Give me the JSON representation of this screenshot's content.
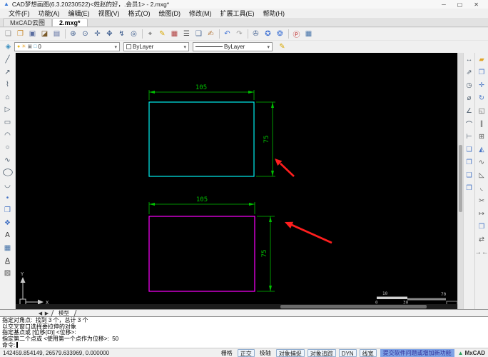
{
  "window": {
    "icon_glyph": "▲",
    "title": "CAD梦想画图(6.3.20230522)<姓赵的好，.会员1> - 2.mxg*",
    "controls": {
      "minimize": "─",
      "maximize": "▢",
      "close": "✕"
    }
  },
  "menu": {
    "items": [
      {
        "name": "menu-file",
        "label": "文件(F)"
      },
      {
        "name": "menu-function",
        "label": "功能(A)"
      },
      {
        "name": "menu-edit",
        "label": "编辑(E)"
      },
      {
        "name": "menu-view",
        "label": "视图(V)"
      },
      {
        "name": "menu-format",
        "label": "格式(O)"
      },
      {
        "name": "menu-draw",
        "label": "绘图(D)"
      },
      {
        "name": "menu-modify",
        "label": "修改(M)"
      },
      {
        "name": "menu-ext-tools",
        "label": "扩展工具(E)"
      },
      {
        "name": "menu-help",
        "label": "帮助(H)"
      }
    ]
  },
  "tabs": [
    {
      "name": "tab-mxcad-cloud",
      "label": "MxCAD云图",
      "active": false
    },
    {
      "name": "tab-drawing-2mxg",
      "label": "2.mxg*",
      "active": true
    }
  ],
  "toolbar_main": {
    "icons": [
      {
        "name": "new-file",
        "glyph": "❏",
        "color": "#8a8a8a"
      },
      {
        "name": "open-file",
        "glyph": "❐",
        "color": "#c8882a"
      },
      {
        "name": "save",
        "glyph": "▣",
        "color": "#5b6ea0"
      },
      {
        "name": "open-folder",
        "glyph": "◪",
        "color": "#7a5a2a"
      },
      {
        "name": "save-as",
        "glyph": "▤",
        "color": "#5b6ea0"
      },
      {
        "name": "zoom-in",
        "glyph": "⊕",
        "color": "#3a5a8c",
        "sep": true
      },
      {
        "name": "zoom-window",
        "glyph": "⊙",
        "color": "#3a5a8c"
      },
      {
        "name": "zoom-extents",
        "glyph": "✛",
        "color": "#3a5a8c"
      },
      {
        "name": "pan",
        "glyph": "✥",
        "color": "#3a5a8c"
      },
      {
        "name": "measure-distance",
        "glyph": "↯",
        "color": "#3a5a8c"
      },
      {
        "name": "zoom-previous",
        "glyph": "◎",
        "color": "#3a5a8c"
      },
      {
        "name": "select-window",
        "glyph": "⌖",
        "color": "#555555",
        "sep": true
      },
      {
        "name": "draw-sketch",
        "glyph": "✎",
        "color": "#d8a800"
      },
      {
        "name": "color-palette",
        "glyph": "▦",
        "color": "#b04040"
      },
      {
        "name": "text-list",
        "glyph": "☰",
        "color": "#444444"
      },
      {
        "name": "layer-properties",
        "glyph": "❑",
        "color": "#3a5a8c"
      },
      {
        "name": "edit-page",
        "glyph": "✍",
        "color": "#b07030"
      },
      {
        "name": "undo",
        "glyph": "↶",
        "color": "#3b6fd4",
        "sep": true
      },
      {
        "name": "redo",
        "glyph": "↷",
        "color": "#9a9a9a"
      },
      {
        "name": "print",
        "glyph": "✇",
        "color": "#3a5a8c",
        "sep": true
      },
      {
        "name": "web-publish",
        "glyph": "✪",
        "color": "#3b6fd4"
      },
      {
        "name": "web-share",
        "glyph": "❂",
        "color": "#3b6fd4"
      },
      {
        "name": "pdf-export",
        "glyph": "Ⓟ",
        "color": "#c43131",
        "sep": true
      },
      {
        "name": "image-export",
        "glyph": "▦",
        "color": "#4472a8"
      }
    ]
  },
  "properties": {
    "layers_manager_glyph": "◈",
    "layer_icons": [
      {
        "name": "layer-on",
        "glyph": "●",
        "color": "#e8b820"
      },
      {
        "name": "layer-freeze",
        "glyph": "☀",
        "color": "#e8a020"
      },
      {
        "name": "layer-lock",
        "glyph": "▣",
        "color": "#8a8a8a"
      },
      {
        "name": "layer-color",
        "glyph": "□",
        "color": "#4aa0c8"
      }
    ],
    "layer_value": "0",
    "color_value": "ByLayer",
    "linetype_value": "ByLayer",
    "dropdown_arrow": "▾",
    "pencil_glyph": "✎"
  },
  "left_toolbar": {
    "icons": [
      {
        "name": "draw-line",
        "glyph": "╱"
      },
      {
        "name": "draw-xline",
        "glyph": "↗"
      },
      {
        "name": "draw-polyline",
        "glyph": "⌇"
      },
      {
        "name": "draw-polygon",
        "glyph": "⌂"
      },
      {
        "name": "draw-wipeout",
        "glyph": "▷"
      },
      {
        "name": "draw-rectangle",
        "glyph": "▭"
      },
      {
        "name": "draw-arc",
        "glyph": "◠"
      },
      {
        "name": "draw-circle",
        "glyph": "○"
      },
      {
        "name": "draw-spline",
        "glyph": "∿"
      },
      {
        "name": "draw-ellipse",
        "glyph": "◯",
        "cls": "wide"
      },
      {
        "name": "draw-ellipse-arc",
        "glyph": "◡"
      },
      {
        "name": "draw-point",
        "glyph": "•",
        "color": "#4472c4"
      },
      {
        "name": "draw-block",
        "glyph": "❒",
        "color": "#4472c4"
      },
      {
        "name": "insert-block",
        "glyph": "❖",
        "color": "#4472c4"
      },
      {
        "name": "draw-text",
        "glyph": "A",
        "color": "#333333"
      },
      {
        "name": "insert-image",
        "glyph": "▦",
        "color": "#4472a8"
      },
      {
        "name": "draw-mtext",
        "glyph": "A",
        "cls": "ul",
        "color": "#333333"
      },
      {
        "name": "draw-hatch",
        "glyph": "▨",
        "color": "#555555"
      }
    ]
  },
  "dim_toolbar": {
    "icons": [
      {
        "name": "dim-linear",
        "glyph": "↔"
      },
      {
        "name": "dim-aligned",
        "glyph": "⇗"
      },
      {
        "name": "dim-radius",
        "glyph": "◷"
      },
      {
        "name": "dim-diameter",
        "glyph": "⌀"
      },
      {
        "name": "dim-angular",
        "glyph": "∠"
      },
      {
        "name": "dim-arc",
        "glyph": "⌒"
      },
      {
        "name": "dim-continue",
        "glyph": "⊢"
      },
      {
        "name": "draworder-front",
        "glyph": "❏",
        "color": "#4472c4"
      },
      {
        "name": "draworder-back",
        "glyph": "❐",
        "color": "#4472c4"
      },
      {
        "name": "draworder-above",
        "glyph": "❑",
        "color": "#4472c4"
      },
      {
        "name": "draworder-below",
        "glyph": "❒",
        "color": "#4472c4"
      }
    ]
  },
  "modify_toolbar": {
    "icons": [
      {
        "name": "erase",
        "glyph": "▰",
        "color": "#e0a52a"
      },
      {
        "name": "copy",
        "glyph": "❐",
        "color": "#4472c4"
      },
      {
        "name": "move",
        "glyph": "✛",
        "color": "#4472c4"
      },
      {
        "name": "rotate",
        "glyph": "↻",
        "color": "#4472c4"
      },
      {
        "name": "scale",
        "glyph": "◱",
        "color": "#555555"
      },
      {
        "name": "offset",
        "glyph": "∥",
        "color": "#555555"
      },
      {
        "name": "array",
        "glyph": "⊞",
        "color": "#555555"
      },
      {
        "name": "mirror",
        "glyph": "◭",
        "color": "#4472c4"
      },
      {
        "name": "spline-edit",
        "glyph": "∿",
        "color": "#555555"
      },
      {
        "name": "chamfer",
        "glyph": "◺",
        "color": "#555555"
      },
      {
        "name": "fillet",
        "glyph": "◟",
        "color": "#555555"
      },
      {
        "name": "trim",
        "glyph": "✂",
        "color": "#555555"
      },
      {
        "name": "extend",
        "glyph": "↦",
        "color": "#555555"
      },
      {
        "name": "box-3d",
        "glyph": "❒",
        "color": "#4472c4"
      },
      {
        "name": "join",
        "glyph": "⇄",
        "color": "#555555"
      },
      {
        "name": "break",
        "glyph": "→←",
        "color": "#555555"
      }
    ]
  },
  "canvas": {
    "rect_top": {
      "color": "#00f0f0",
      "width_label": "105",
      "height_label": "75"
    },
    "rect_bottom": {
      "color": "#ff00ff",
      "width_label": "105",
      "height_label": "75"
    },
    "dim_color": "#00c000",
    "arrow_color": "#ff1e1e",
    "ucs": {
      "x_label": "X",
      "y_label": "Y"
    },
    "scale_bar": {
      "top_left": "10",
      "top_right": "70",
      "bottom_left": "0",
      "bottom_mid": "30"
    }
  },
  "model_strip": {
    "nav_left": "◀",
    "nav_right": "▶",
    "tab_label": "模型"
  },
  "command": {
    "lines": [
      "指定对角点:  找到 3 个，总计 3 个",
      "以交叉窗口选择要拉伸的对象",
      "指定基点或 [位移(D)] <位移>:",
      "指定第二个点或 <使用第一个点作为位移>:  50"
    ],
    "prompt": "命令:"
  },
  "statusbar": {
    "coords": "142459.854149, 26579.633969, 0.000000",
    "toggles": [
      {
        "name": "toggle-grid",
        "label": "栅格",
        "boxed": false
      },
      {
        "name": "toggle-ortho",
        "label": "正交",
        "boxed": true
      },
      {
        "name": "toggle-polar",
        "label": "极轴",
        "boxed": false
      },
      {
        "name": "toggle-osnap",
        "label": "对象捕捉",
        "boxed": true
      },
      {
        "name": "toggle-otrack",
        "label": "对象追踪",
        "boxed": true
      },
      {
        "name": "toggle-dyn",
        "label": "DYN",
        "boxed": true
      },
      {
        "name": "toggle-lineweight",
        "label": "线宽",
        "boxed": true
      }
    ],
    "feedback_link": "提交软件问题或增加新功能",
    "brand_logo_glyph": "▲",
    "brand": "MxCAD"
  }
}
